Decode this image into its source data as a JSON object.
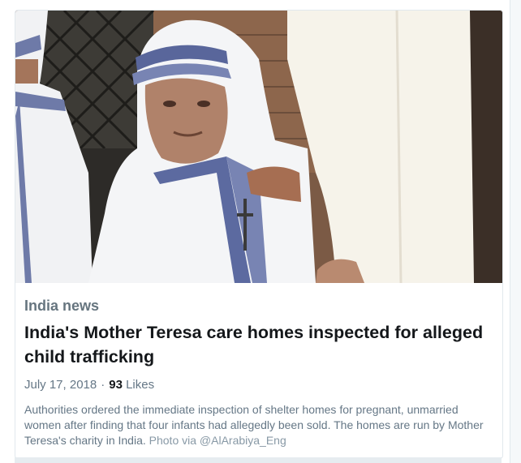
{
  "article": {
    "category": "India news",
    "headline": "India's Mother Teresa care homes inspected for alleged child trafficking",
    "date": "July 17, 2018",
    "separator": "·",
    "likes_count": "93",
    "likes_label": "Likes",
    "description": "Authorities ordered the immediate inspection of shelter homes for pregnant, unmarried women after finding that four infants had allegedly been sold. The homes are run by Mother Teresa's charity in India.",
    "photo_credit": "Photo via @AlArabiya_Eng"
  },
  "colors": {
    "category": "#66757f",
    "headline": "#14171a",
    "meta": "#657786",
    "credit": "#8899a6"
  }
}
